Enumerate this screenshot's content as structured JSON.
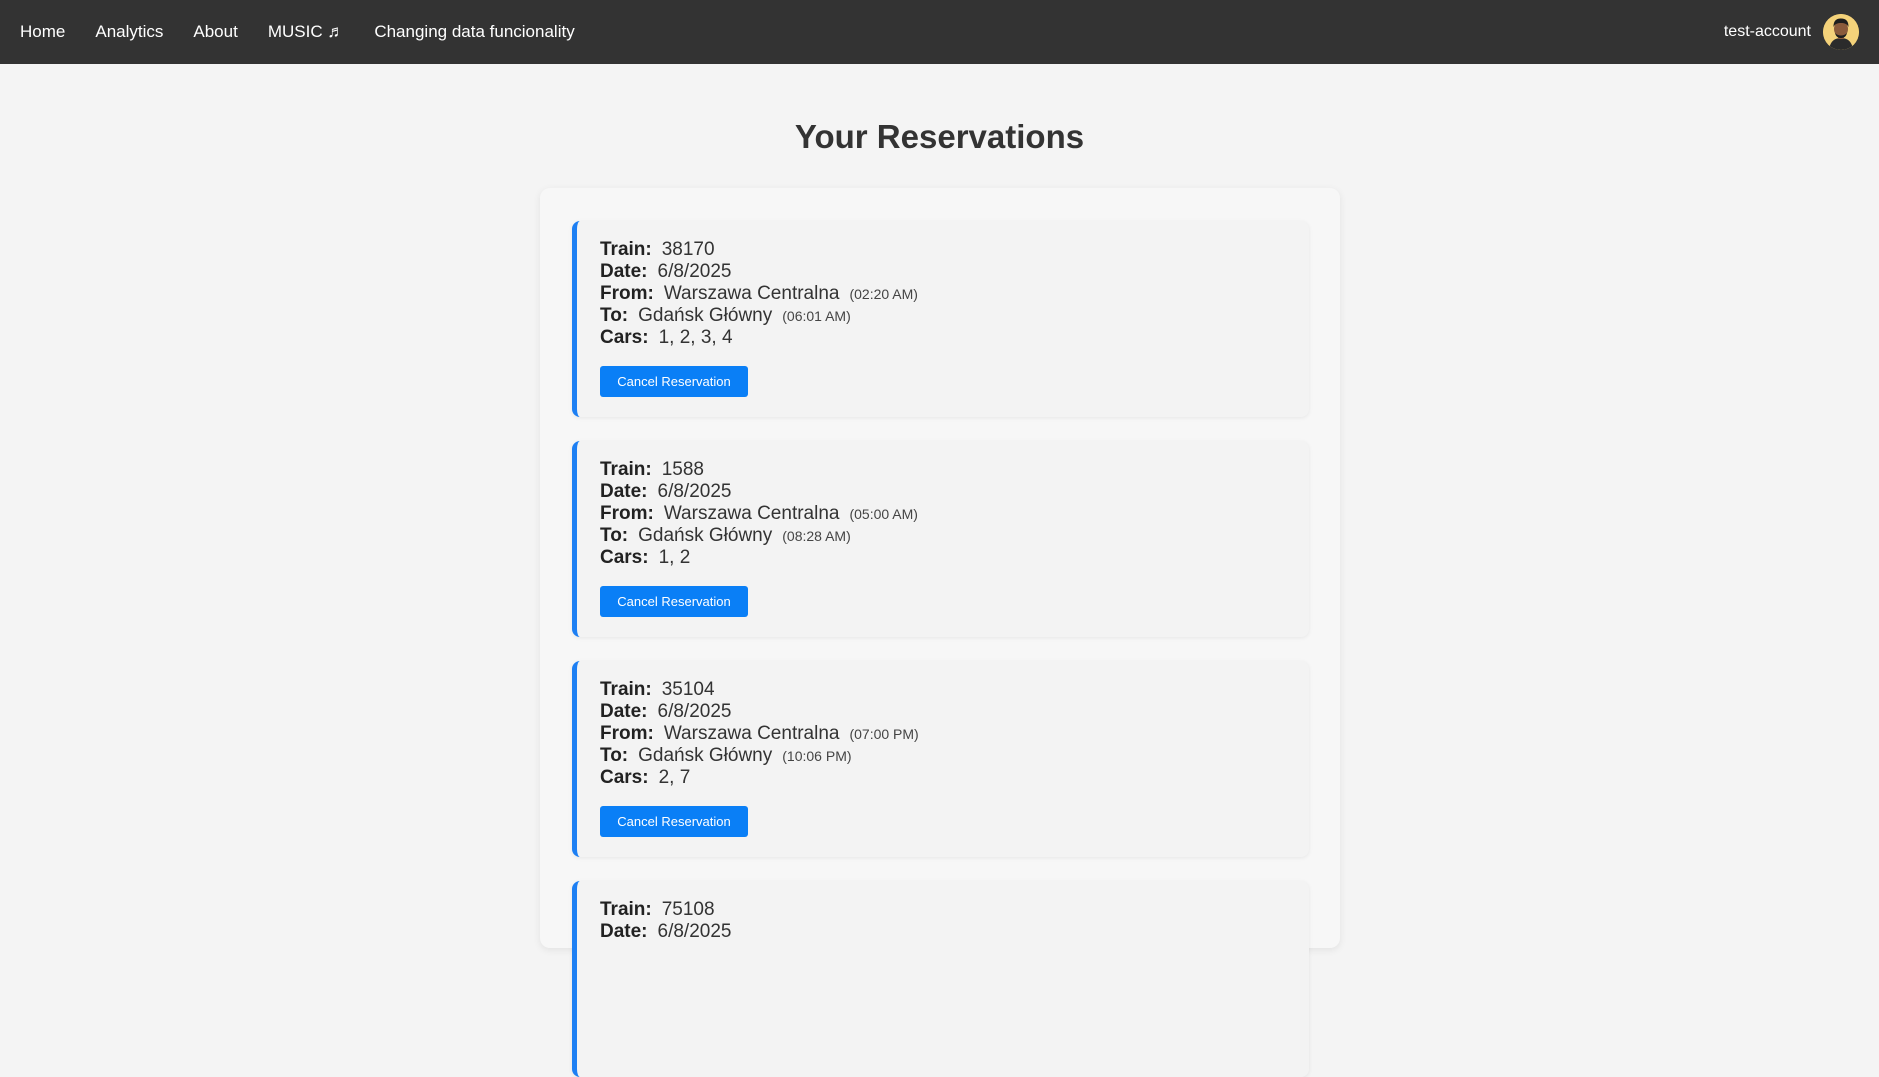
{
  "nav": {
    "links": [
      "Home",
      "Analytics",
      "About",
      "MUSIC ♬",
      "Changing data funcionality"
    ],
    "username": "test-account"
  },
  "page": {
    "title": "Your Reservations"
  },
  "labels": {
    "train": "Train:",
    "date": "Date:",
    "from": "From:",
    "to": "To:",
    "cars": "Cars:",
    "cancel": "Cancel Reservation"
  },
  "reservations": [
    {
      "train": "38170",
      "date": "6/8/2025",
      "from": "Warszawa Centralna",
      "from_time": "(02:20 AM)",
      "to": "Gdańsk Główny",
      "to_time": "(06:01 AM)",
      "cars": "1, 2, 3, 4"
    },
    {
      "train": "1588",
      "date": "6/8/2025",
      "from": "Warszawa Centralna",
      "from_time": "(05:00 AM)",
      "to": "Gdańsk Główny",
      "to_time": "(08:28 AM)",
      "cars": "1, 2"
    },
    {
      "train": "35104",
      "date": "6/8/2025",
      "from": "Warszawa Centralna",
      "from_time": "(07:00 PM)",
      "to": "Gdańsk Główny",
      "to_time": "(10:06 PM)",
      "cars": "2, 7"
    },
    {
      "train": "75108",
      "date": "6/8/2025",
      "from": "",
      "from_time": "",
      "to": "",
      "to_time": "",
      "cars": ""
    }
  ],
  "colors": {
    "navbar": "#333333",
    "accent": "#1d7ff3",
    "button": "#0a7ff6",
    "background": "#f4f4f4"
  }
}
